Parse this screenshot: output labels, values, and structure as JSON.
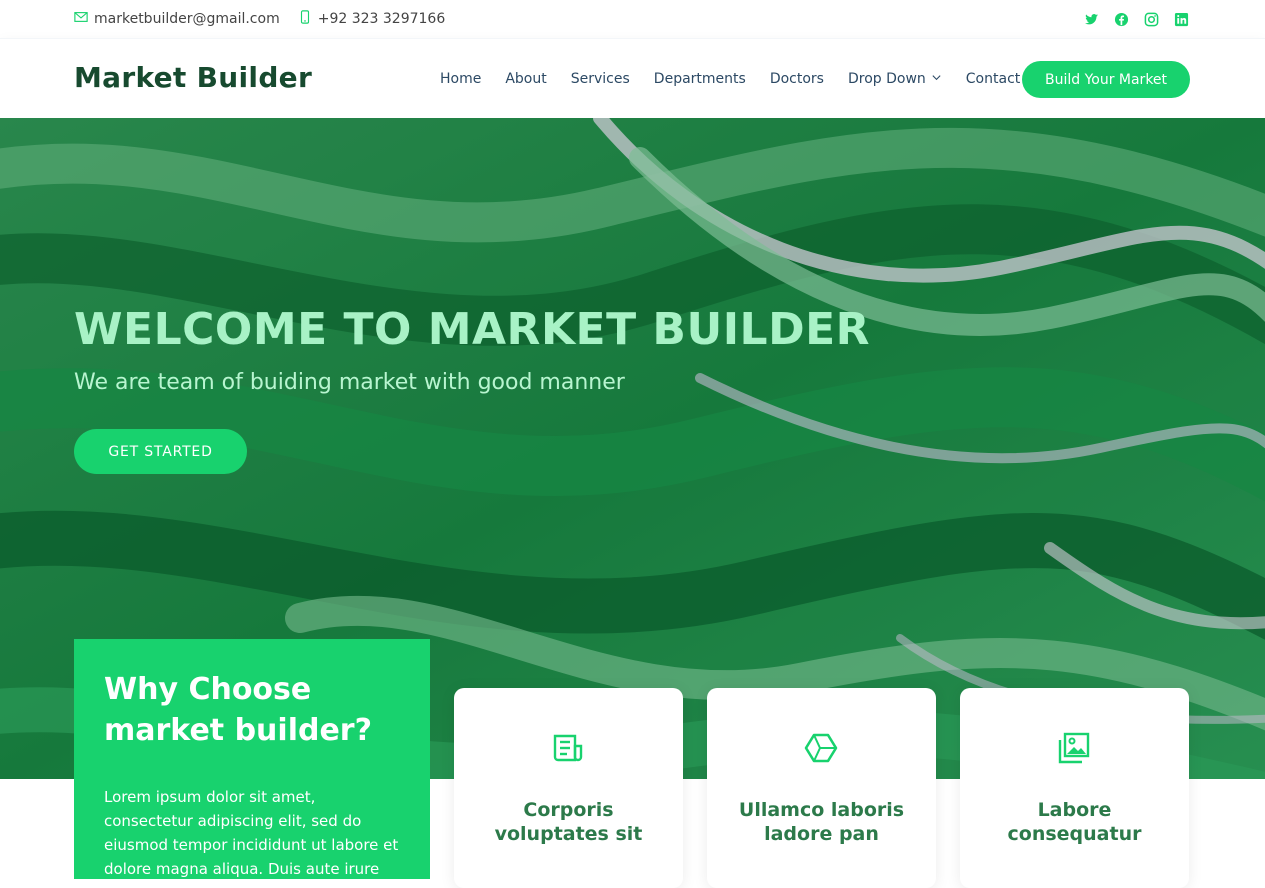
{
  "topbar": {
    "email": "marketbuilder@gmail.com",
    "phone": "+92 323 3297166",
    "social": [
      "twitter-icon",
      "facebook-icon",
      "instagram-icon",
      "linkedin-icon"
    ]
  },
  "header": {
    "logo": "Market Builder",
    "nav": [
      "Home",
      "About",
      "Services",
      "Departments",
      "Doctors",
      "Drop Down",
      "Contact"
    ],
    "cta": "Build Your Market"
  },
  "hero": {
    "title": "WELCOME TO MARKET BUILDER",
    "subtitle": "We are team of buiding market with good manner",
    "button": "GET STARTED"
  },
  "why": {
    "title_line1": "Why Choose",
    "title_line2": "market builder?",
    "text": "Lorem ipsum dolor sit amet, consectetur adipiscing elit, sed do eiusmod tempor incididunt ut labore et dolore magna aliqua. Duis aute irure"
  },
  "cards": [
    {
      "icon": "receipt-icon",
      "line1": "Corporis",
      "line2": "voluptates sit"
    },
    {
      "icon": "cube-icon",
      "line1": "Ullamco laboris",
      "line2": "ladore pan"
    },
    {
      "icon": "images-icon",
      "line1": "Labore",
      "line2": "consequatur"
    }
  ],
  "colors": {
    "accent": "#18d26e",
    "dark_green": "#174a2f",
    "text": "#2c4964"
  }
}
